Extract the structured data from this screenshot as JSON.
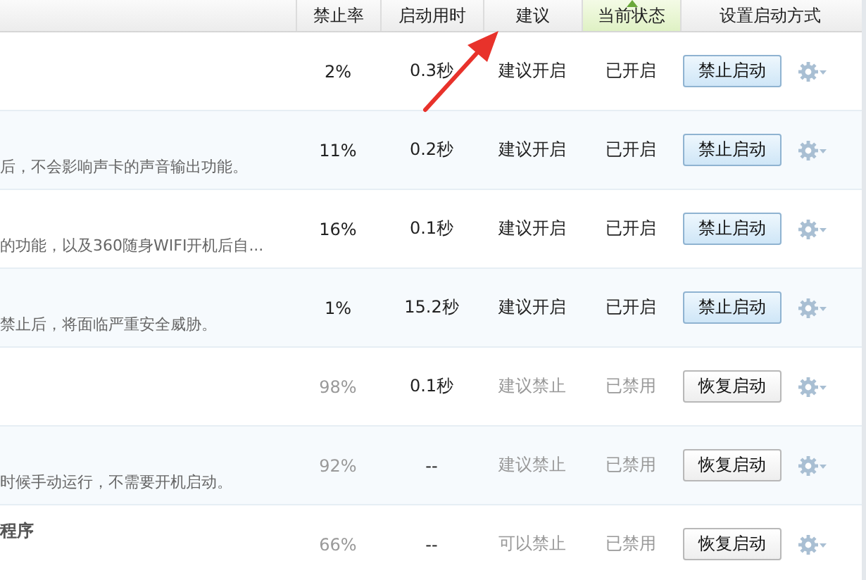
{
  "columns": [
    {
      "label": "禁止率",
      "sorted": false
    },
    {
      "label": "启动用时",
      "sorted": false
    },
    {
      "label": "建议",
      "sorted": false
    },
    {
      "label": "当前状态",
      "sorted": true
    },
    {
      "label": "设置启动方式",
      "sorted": false
    }
  ],
  "rows": [
    {
      "name": "",
      "description": "",
      "rate": "2%",
      "time": "0.3秒",
      "suggestion": "建议开启",
      "status": "已开启",
      "enabled": true,
      "action": "禁止启动"
    },
    {
      "name": "",
      "description": "后，不会影响声卡的声音输出功能。",
      "rate": "11%",
      "time": "0.2秒",
      "suggestion": "建议开启",
      "status": "已开启",
      "enabled": true,
      "action": "禁止启动"
    },
    {
      "name": "",
      "description": "的功能，以及360随身WIFI开机后自...",
      "rate": "16%",
      "time": "0.1秒",
      "suggestion": "建议开启",
      "status": "已开启",
      "enabled": true,
      "action": "禁止启动"
    },
    {
      "name": "",
      "description": "禁止后，将面临严重安全威胁。",
      "rate": "1%",
      "time": "15.2秒",
      "suggestion": "建议开启",
      "status": "已开启",
      "enabled": true,
      "action": "禁止启动"
    },
    {
      "name": "",
      "description": "",
      "rate": "98%",
      "time": "0.1秒",
      "suggestion": "建议禁止",
      "status": "已禁用",
      "enabled": false,
      "action": "恢复启动"
    },
    {
      "name": "",
      "description": "时候手动运行，不需要开机启动。",
      "rate": "92%",
      "time": "--",
      "suggestion": "建议禁止",
      "status": "已禁用",
      "enabled": false,
      "action": "恢复启动"
    },
    {
      "name": "程序",
      "description": "",
      "rate": "66%",
      "time": "--",
      "suggestion": "可以禁止",
      "status": "已禁用",
      "enabled": false,
      "action": "恢复启动"
    }
  ],
  "annotation": {
    "kind": "arrow"
  }
}
